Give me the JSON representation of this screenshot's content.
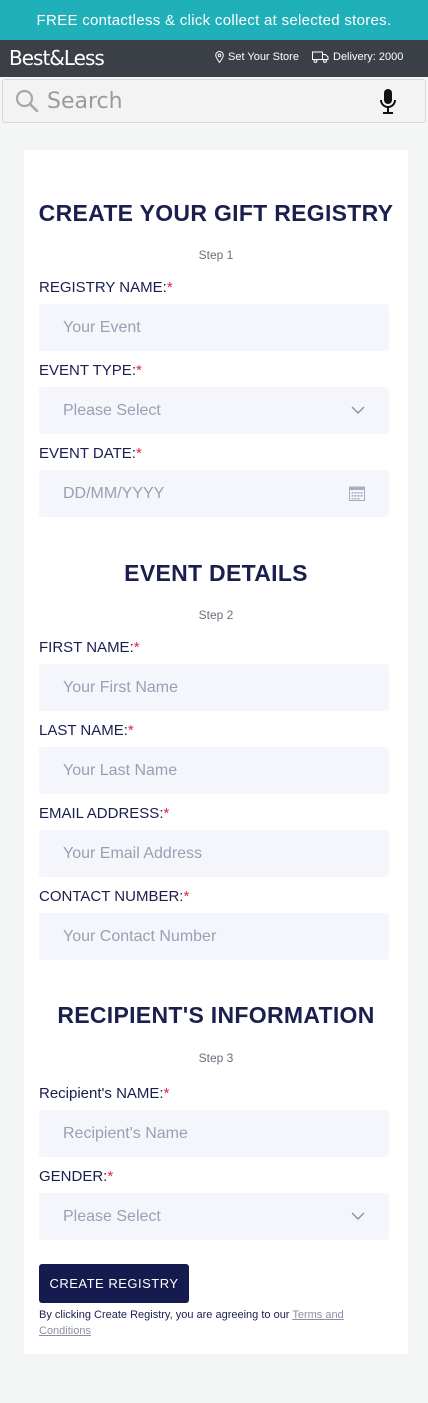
{
  "promo": {
    "text": "FREE contactless & click collect at selected stores."
  },
  "header": {
    "logo": "Best&Less",
    "store_label": "Set Your Store",
    "delivery_label": "Delivery: 2000",
    "icons": [
      "map-pin-icon",
      "truck-icon"
    ]
  },
  "search": {
    "placeholder": "Search",
    "icons": [
      "search-icon",
      "microphone-icon"
    ]
  },
  "sections": {
    "create": {
      "title": "CREATE YOUR GIFT REGISTRY",
      "step": "Step 1"
    },
    "event": {
      "title": "EVENT DETAILS",
      "step": "Step 2"
    },
    "recipient": {
      "title": "RECIPIENT'S INFORMATION",
      "step": "Step 3"
    }
  },
  "fields": {
    "registry_name": {
      "label": "REGISTRY NAME:",
      "placeholder": "Your Event"
    },
    "event_type": {
      "label": "EVENT TYPE:",
      "value": "Please Select"
    },
    "event_date": {
      "label": "EVENT DATE:",
      "placeholder": "DD/MM/YYYY"
    },
    "first_name": {
      "label": "FIRST NAME:",
      "placeholder": "Your First Name"
    },
    "last_name": {
      "label": "LAST NAME:",
      "placeholder": "Your Last Name"
    },
    "email": {
      "label": "EMAIL ADDRESS:",
      "placeholder": "Your Email Address"
    },
    "contact": {
      "label": "CONTACT NUMBER:",
      "placeholder": "Your Contact Number"
    },
    "recipient_name": {
      "label": "Recipient's NAME:",
      "placeholder": "Recipient's Name"
    },
    "gender": {
      "label": "GENDER:",
      "value": "Please Select"
    }
  },
  "required_mark": "*",
  "button": {
    "label": "CREATE REGISTRY"
  },
  "terms": {
    "text": "By clicking Create Registry, you are agreeing to our ",
    "link": "Terms and Conditions"
  },
  "colors": {
    "promo_bg": "#1fb0b9",
    "header_bg": "#3a4046",
    "navy": "#1a1f4e",
    "required": "#e0244d",
    "field_bg": "#f5f6fb"
  }
}
